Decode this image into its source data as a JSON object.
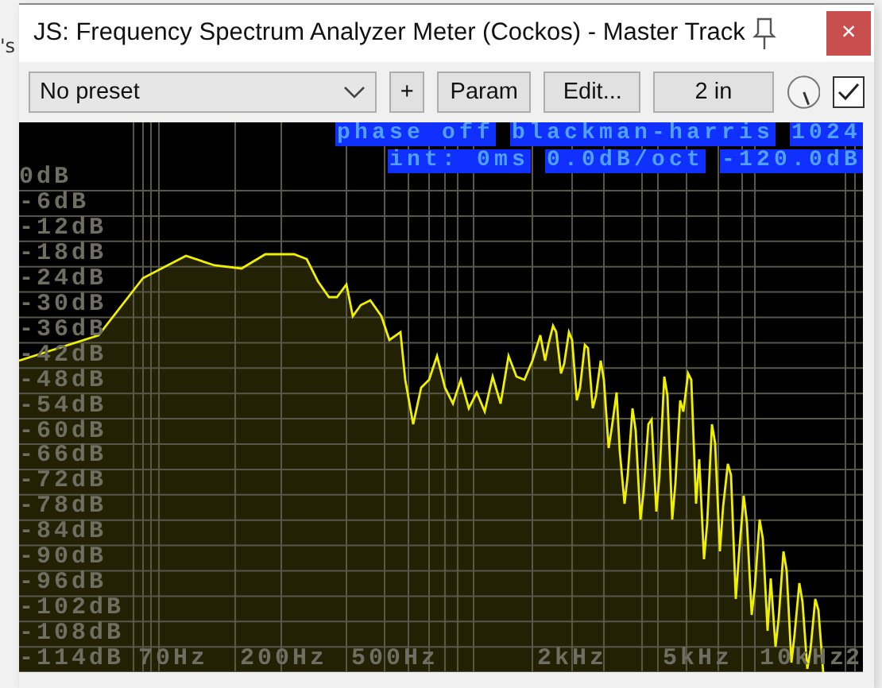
{
  "background_text": "'s",
  "window": {
    "title": "JS: Frequency Spectrum Analyzer Meter (Cockos) - Master Track",
    "close": "×"
  },
  "toolbar": {
    "preset": "No preset",
    "buttons": [
      "+",
      "Param",
      "Edit...",
      "2 in"
    ],
    "checked": true
  },
  "analyzer": {
    "info_rows": [
      [
        "phase off",
        "blackman-harris",
        "1024"
      ],
      [
        "int: 0ms",
        "0.0dB/oct",
        "-120.0dB"
      ]
    ],
    "db_labels": [
      "0dB",
      "-6dB",
      "-12dB",
      "-18dB",
      "-24dB",
      "-30dB",
      "-36dB",
      "-42dB",
      "-48dB",
      "-54dB",
      "-60dB",
      "-66dB",
      "-72dB",
      "-78dB",
      "-84dB",
      "-90dB",
      "-96dB",
      "-102dB",
      "-108dB",
      "-114dB"
    ],
    "freq_labels": [
      "70Hz",
      "200Hz",
      "500Hz",
      "2kHz",
      "5kHz",
      "10kHz",
      "2"
    ]
  }
}
